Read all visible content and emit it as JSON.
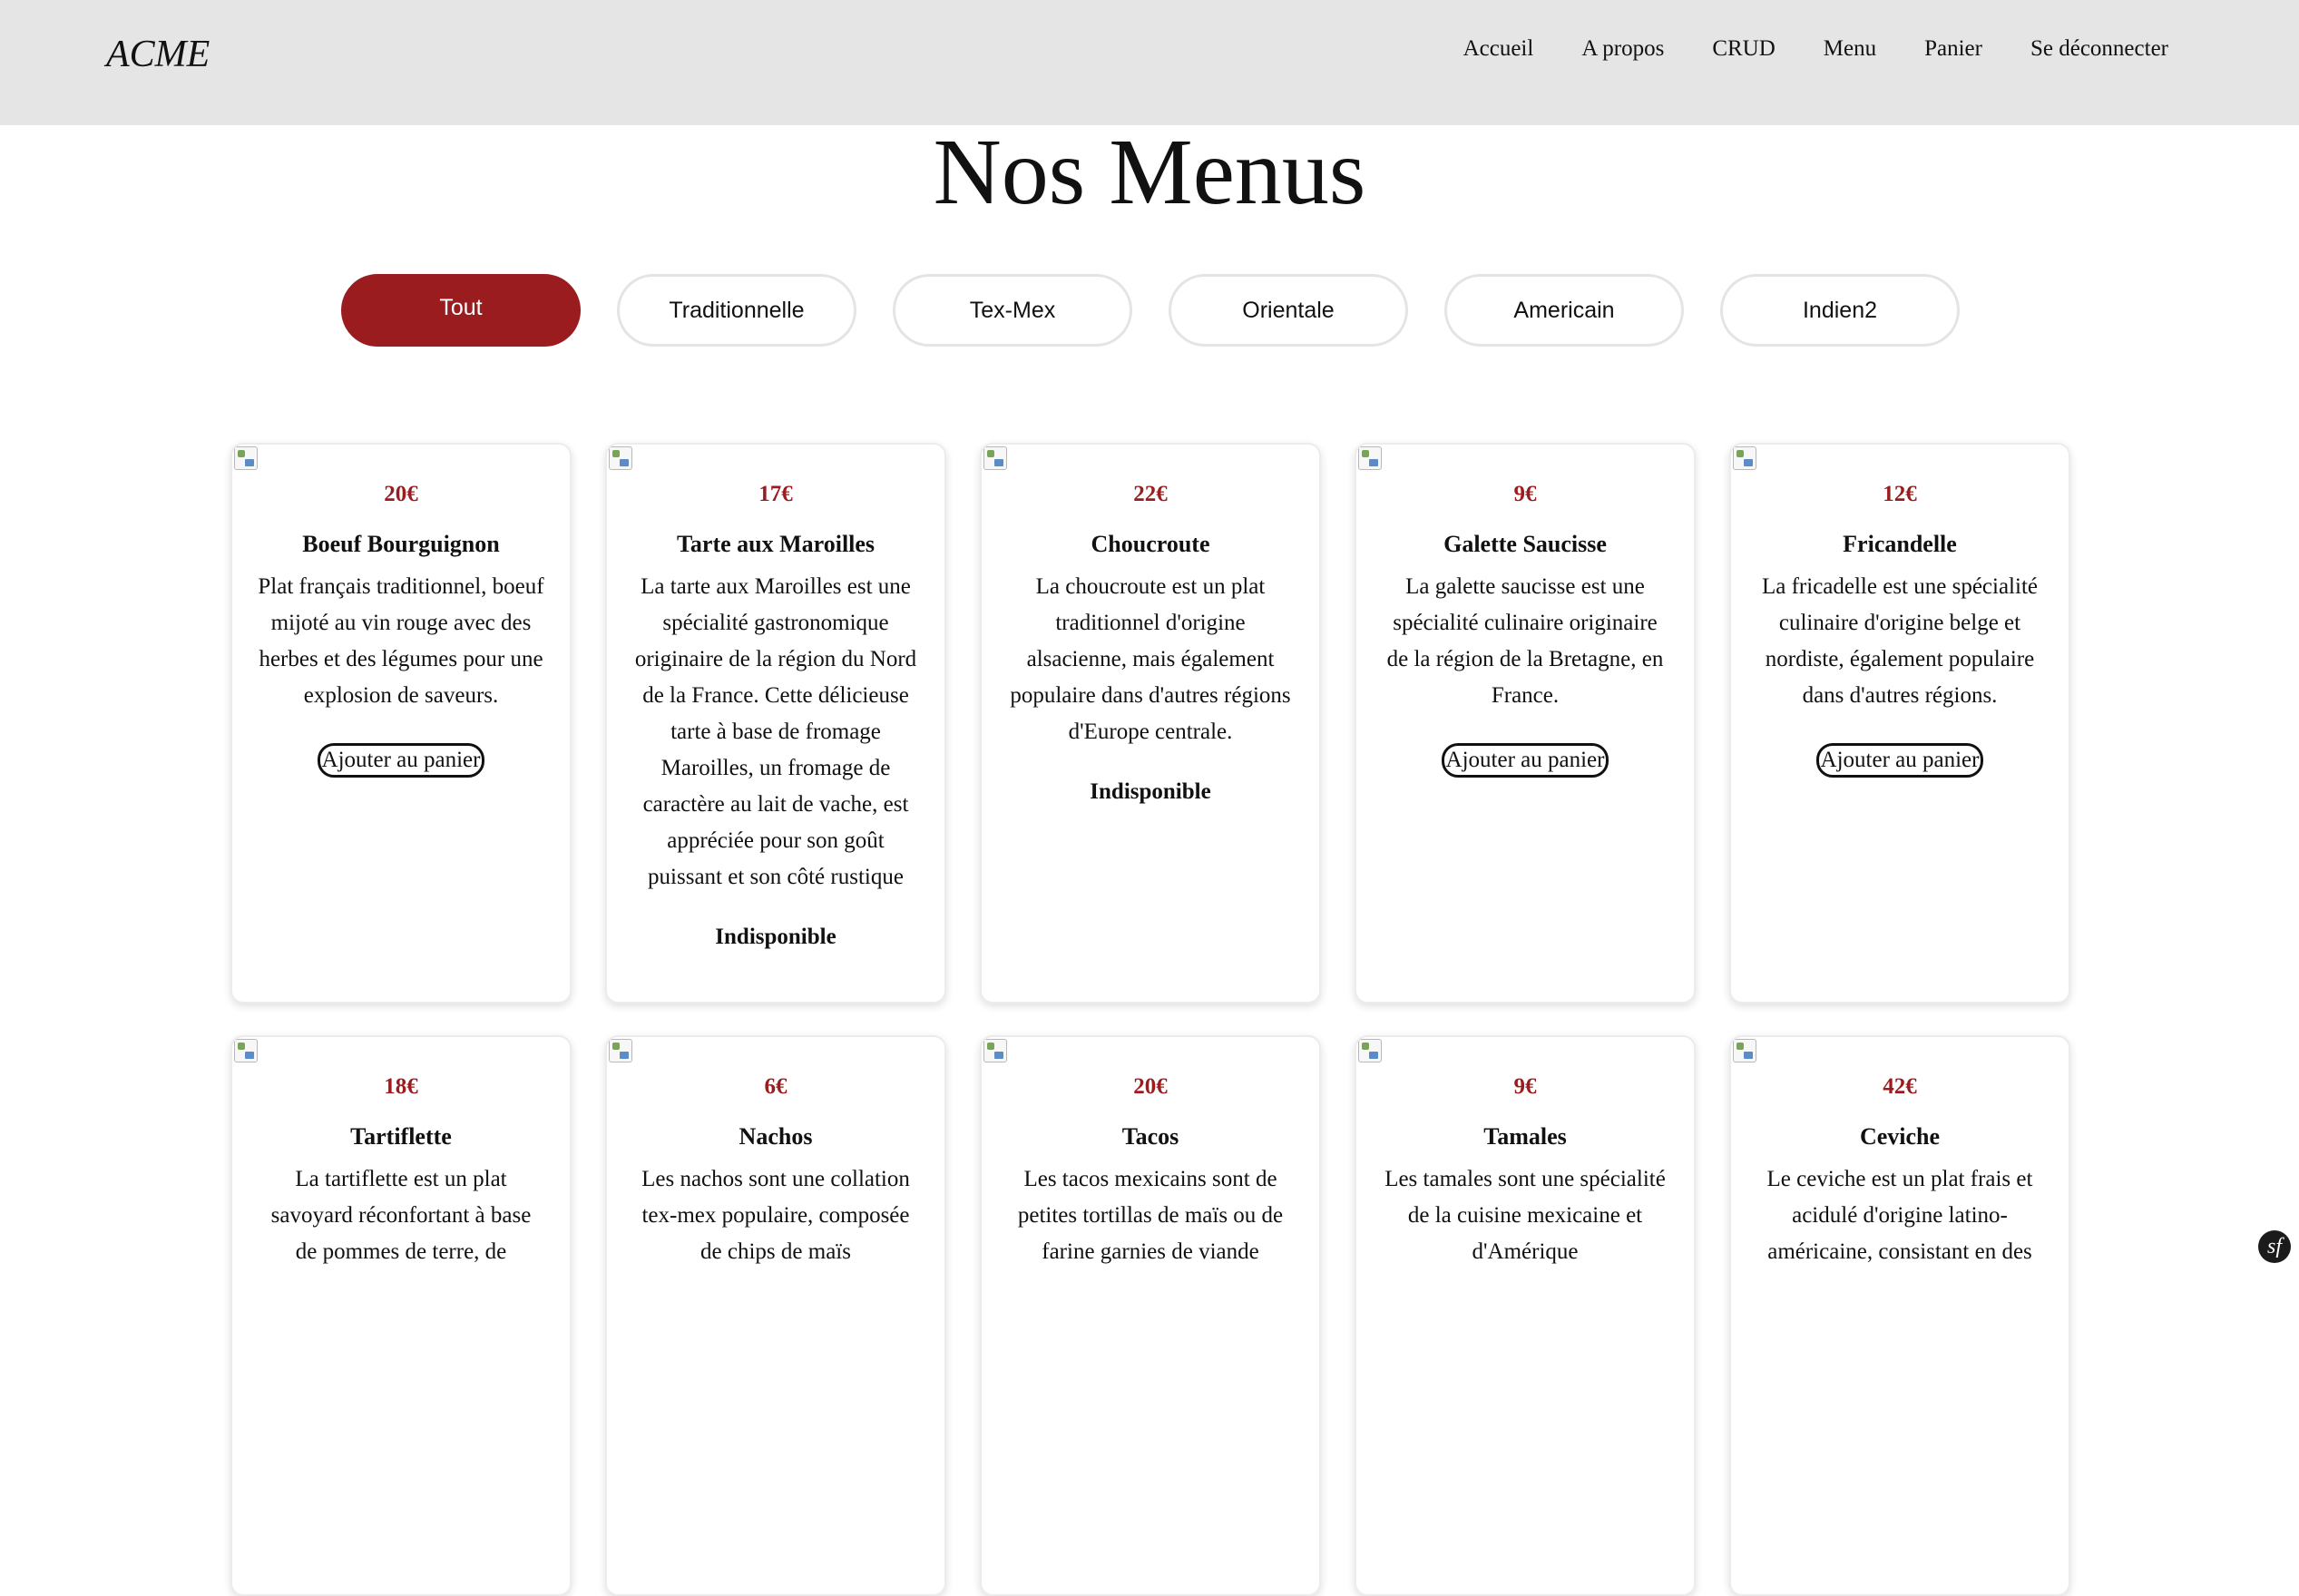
{
  "header": {
    "brand": "ACME",
    "nav": [
      "Accueil",
      "A propos",
      "CRUD",
      "Menu",
      "Panier",
      "Se déconnecter"
    ]
  },
  "page": {
    "title": "Nos Menus"
  },
  "filters": {
    "items": [
      "Tout",
      "Traditionnelle",
      "Tex-Mex",
      "Orientale",
      "Americain",
      "Indien2"
    ],
    "active": "Tout"
  },
  "cards": [
    {
      "price": "20€",
      "name": "Boeuf Bourguignon",
      "description": "Plat français traditionnel, boeuf mijoté au vin rouge avec des herbes et des légumes pour une explosion de saveurs.",
      "available": true,
      "action_label": "Ajouter au panier"
    },
    {
      "price": "17€",
      "name": "Tarte aux Maroilles",
      "description": "La tarte aux Maroilles est une spécialité gastronomique originaire de la région du Nord de la France. Cette délicieuse tarte à base de fromage Maroilles, un fromage de caractère au lait de vache, est appréciée pour son goût puissant et son côté rustique",
      "available": false,
      "status_label": "Indisponible"
    },
    {
      "price": "22€",
      "name": "Choucroute",
      "description": "La choucroute est un plat traditionnel d'origine alsacienne, mais également populaire dans d'autres régions d'Europe centrale.",
      "available": false,
      "status_label": "Indisponible"
    },
    {
      "price": "9€",
      "name": "Galette Saucisse",
      "description": "La galette saucisse est une spécialité culinaire originaire de la région de la Bretagne, en France.",
      "available": true,
      "action_label": "Ajouter au panier"
    },
    {
      "price": "12€",
      "name": "Fricandelle",
      "description": "La fricadelle est une spécialité culinaire d'origine belge et nordiste, également populaire dans d'autres régions.",
      "available": true,
      "action_label": "Ajouter au panier"
    },
    {
      "price": "18€",
      "name": "Tartiflette",
      "description": "La tartiflette est un plat savoyard réconfortant à base de pommes de terre, de",
      "available": true,
      "action_label": ""
    },
    {
      "price": "6€",
      "name": "Nachos",
      "description": "Les nachos sont une collation tex-mex populaire, composée de chips de maïs",
      "available": true,
      "action_label": ""
    },
    {
      "price": "20€",
      "name": "Tacos",
      "description": "Les tacos mexicains sont de petites tortillas de maïs ou de farine garnies de viande",
      "available": true,
      "action_label": ""
    },
    {
      "price": "9€",
      "name": "Tamales",
      "description": "Les tamales sont une spécialité de la cuisine mexicaine et d'Amérique",
      "available": true,
      "action_label": ""
    },
    {
      "price": "42€",
      "name": "Ceviche",
      "description": "Le ceviche est un plat frais et acidulé d'origine latino-américaine, consistant en des",
      "available": true,
      "action_label": ""
    }
  ],
  "icons": {
    "card_image": "broken-image-icon",
    "debug_badge": "symfony-logo-icon"
  },
  "colors": {
    "accent": "#9a1c1f",
    "navbar_bg": "#e5e5e5"
  }
}
